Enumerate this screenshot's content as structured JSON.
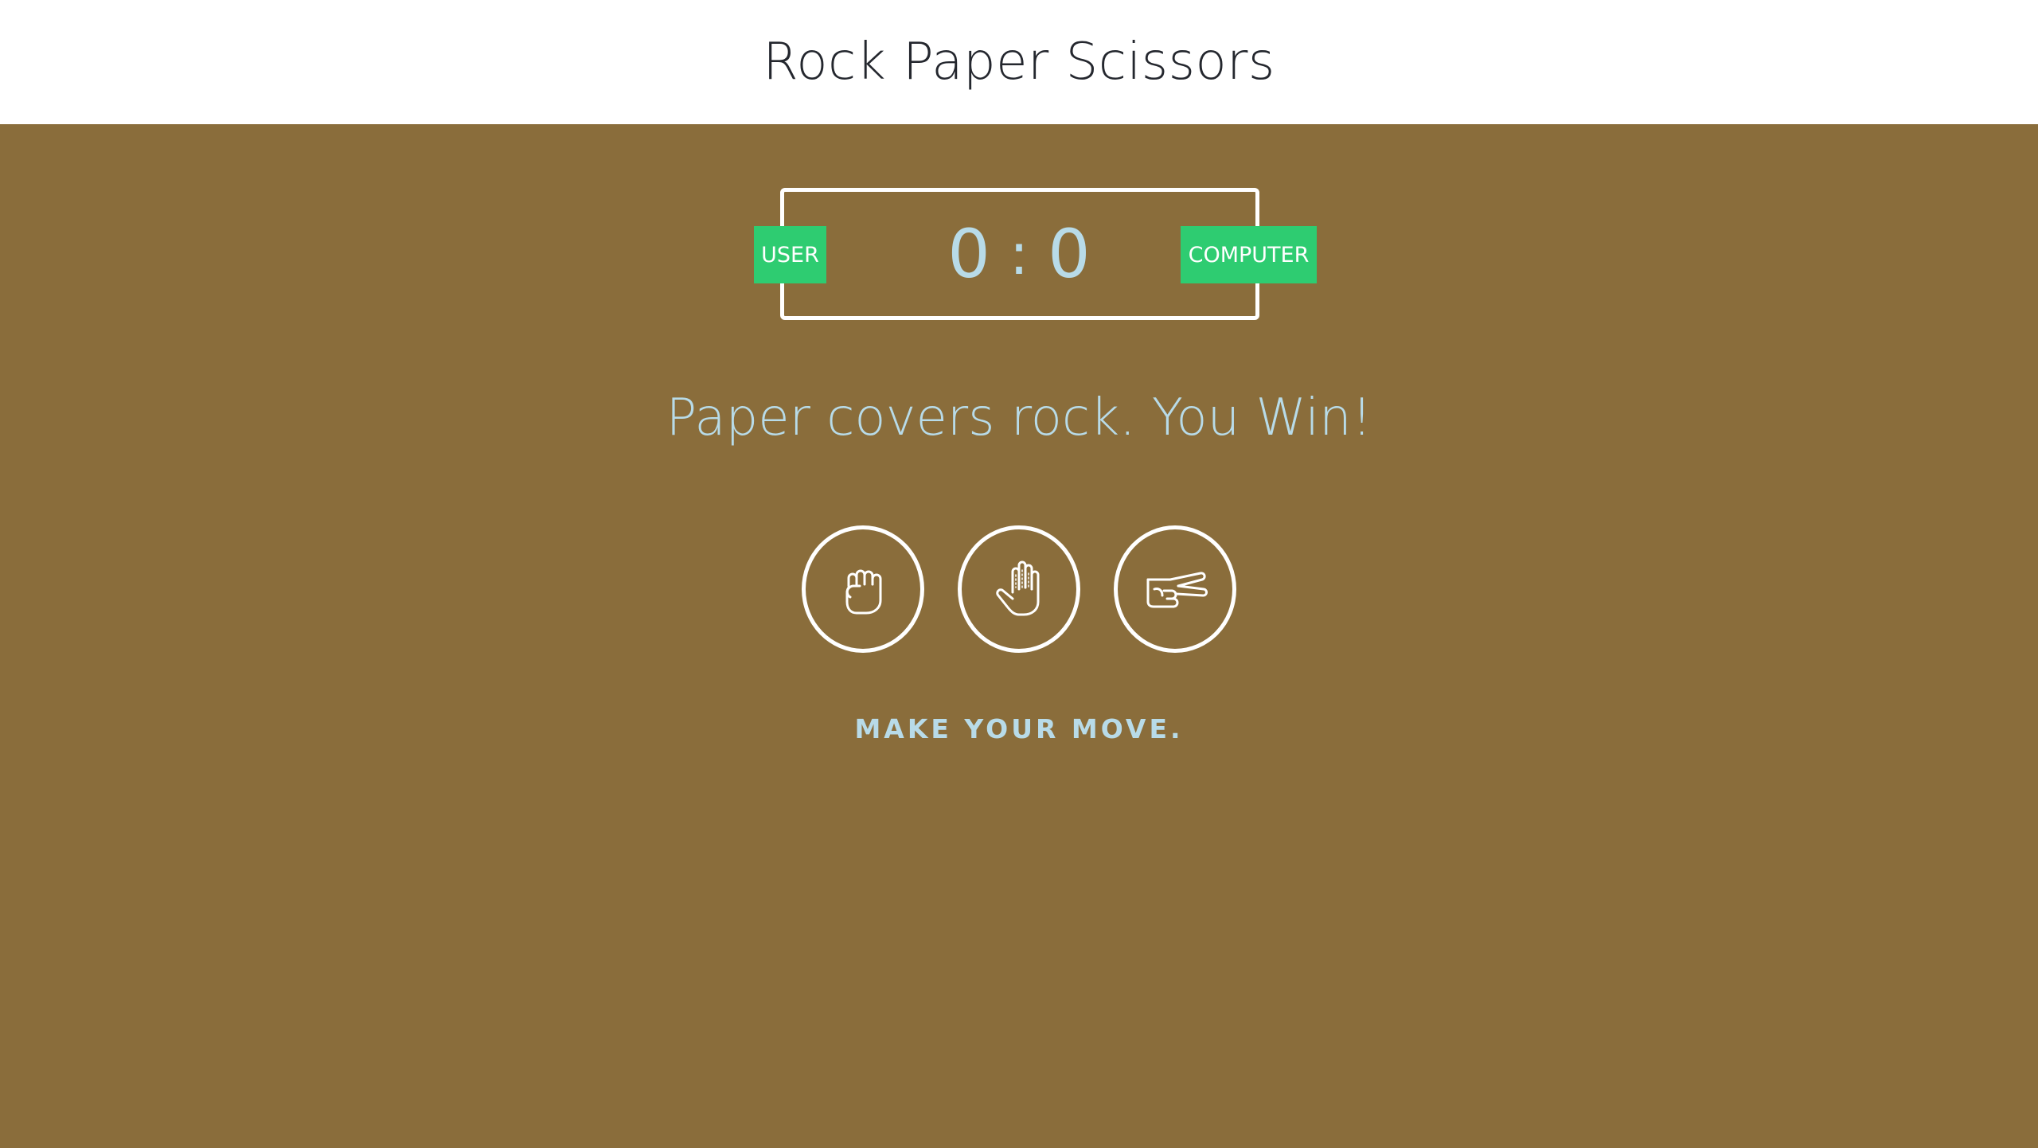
{
  "header": {
    "title": "Rock Paper Scissors"
  },
  "scoreboard": {
    "user_label": "USER",
    "computer_label": "COMPUTER",
    "user_score": "0",
    "separator": ":",
    "computer_score": "0"
  },
  "result": {
    "message": "Paper covers rock. You Win!"
  },
  "choices": [
    {
      "name": "rock",
      "icon": "rock-hand-icon"
    },
    {
      "name": "paper",
      "icon": "paper-hand-icon"
    },
    {
      "name": "scissors",
      "icon": "scissors-hand-icon"
    }
  ],
  "prompt": {
    "text": "MAKE YOUR MOVE."
  },
  "colors": {
    "background": "#8a6d3b",
    "header_bg": "#ffffff",
    "accent_green": "#2ecc71",
    "text_light_blue": "#b8dbe8",
    "outline_white": "#ffffff"
  }
}
